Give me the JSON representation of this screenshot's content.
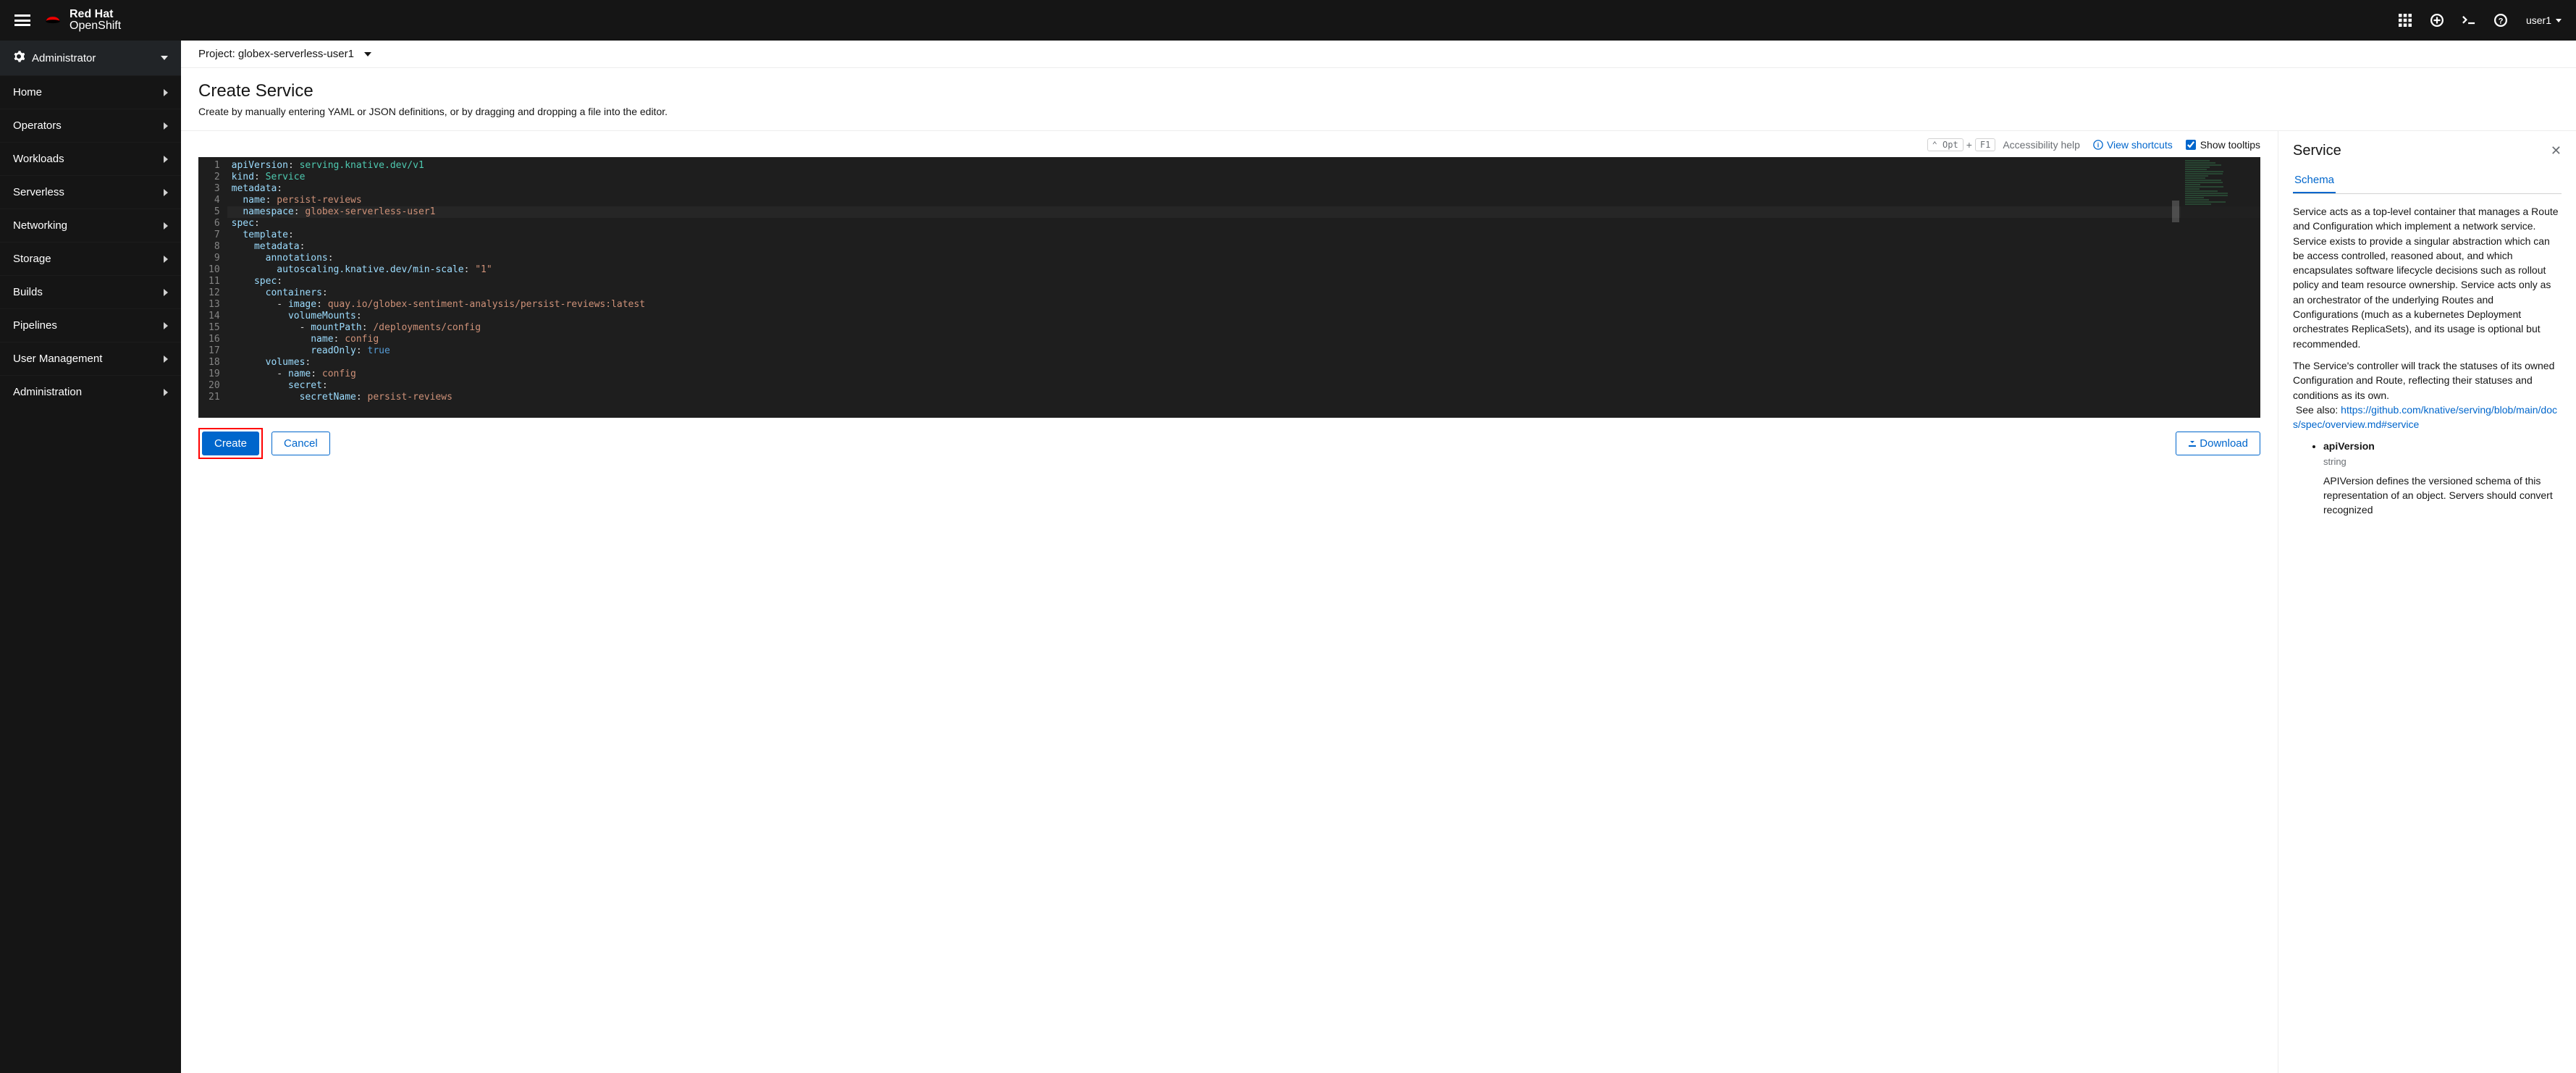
{
  "brand": {
    "line1": "Red Hat",
    "line2": "OpenShift"
  },
  "user": {
    "name": "user1"
  },
  "perspective": {
    "label": "Administrator"
  },
  "nav": [
    {
      "label": "Home"
    },
    {
      "label": "Operators"
    },
    {
      "label": "Workloads"
    },
    {
      "label": "Serverless"
    },
    {
      "label": "Networking"
    },
    {
      "label": "Storage"
    },
    {
      "label": "Builds"
    },
    {
      "label": "Pipelines"
    },
    {
      "label": "User Management"
    },
    {
      "label": "Administration"
    }
  ],
  "project": {
    "prefix": "Project:",
    "name": "globex-serverless-user1"
  },
  "page": {
    "title": "Create Service",
    "subtitle": "Create by manually entering YAML or JSON definitions, or by dragging and dropping a file into the editor."
  },
  "toolbar": {
    "kbd1": "⌃ Opt",
    "plus": "+",
    "kbd2": "F1",
    "a11y": "Accessibility help",
    "shortcuts": "View shortcuts",
    "tooltips": "Show tooltips"
  },
  "yaml": {
    "lines": [
      [
        [
          "key",
          "apiVersion"
        ],
        [
          "punc",
          ": "
        ],
        [
          "type",
          "serving.knative.dev/v1"
        ]
      ],
      [
        [
          "key",
          "kind"
        ],
        [
          "punc",
          ": "
        ],
        [
          "type",
          "Service"
        ]
      ],
      [
        [
          "key",
          "metadata"
        ],
        [
          "punc",
          ":"
        ]
      ],
      [
        [
          "pad",
          "  "
        ],
        [
          "key",
          "name"
        ],
        [
          "punc",
          ": "
        ],
        [
          "str",
          "persist-reviews"
        ]
      ],
      [
        [
          "pad",
          "  "
        ],
        [
          "key",
          "namespace"
        ],
        [
          "punc",
          ": "
        ],
        [
          "str",
          "globex-serverless-user1"
        ]
      ],
      [
        [
          "key",
          "spec"
        ],
        [
          "punc",
          ":"
        ]
      ],
      [
        [
          "pad",
          "  "
        ],
        [
          "key",
          "template"
        ],
        [
          "punc",
          ":"
        ]
      ],
      [
        [
          "pad",
          "    "
        ],
        [
          "key",
          "metadata"
        ],
        [
          "punc",
          ":"
        ]
      ],
      [
        [
          "pad",
          "      "
        ],
        [
          "key",
          "annotations"
        ],
        [
          "punc",
          ":"
        ]
      ],
      [
        [
          "pad",
          "        "
        ],
        [
          "key",
          "autoscaling.knative.dev/min-scale"
        ],
        [
          "punc",
          ": "
        ],
        [
          "str",
          "\"1\""
        ]
      ],
      [
        [
          "pad",
          "    "
        ],
        [
          "key",
          "spec"
        ],
        [
          "punc",
          ":"
        ]
      ],
      [
        [
          "pad",
          "      "
        ],
        [
          "key",
          "containers"
        ],
        [
          "punc",
          ":"
        ]
      ],
      [
        [
          "pad",
          "        "
        ],
        [
          "dash",
          "- "
        ],
        [
          "key",
          "image"
        ],
        [
          "punc",
          ": "
        ],
        [
          "str",
          "quay.io/globex-sentiment-analysis/persist-reviews:latest"
        ]
      ],
      [
        [
          "pad",
          "          "
        ],
        [
          "key",
          "volumeMounts"
        ],
        [
          "punc",
          ":"
        ]
      ],
      [
        [
          "pad",
          "            "
        ],
        [
          "dash",
          "- "
        ],
        [
          "key",
          "mountPath"
        ],
        [
          "punc",
          ": "
        ],
        [
          "str",
          "/deployments/config"
        ]
      ],
      [
        [
          "pad",
          "              "
        ],
        [
          "key",
          "name"
        ],
        [
          "punc",
          ": "
        ],
        [
          "str",
          "config"
        ]
      ],
      [
        [
          "pad",
          "              "
        ],
        [
          "key",
          "readOnly"
        ],
        [
          "punc",
          ": "
        ],
        [
          "bool",
          "true"
        ]
      ],
      [
        [
          "pad",
          "      "
        ],
        [
          "key",
          "volumes"
        ],
        [
          "punc",
          ":"
        ]
      ],
      [
        [
          "pad",
          "        "
        ],
        [
          "dash",
          "- "
        ],
        [
          "key",
          "name"
        ],
        [
          "punc",
          ": "
        ],
        [
          "str",
          "config"
        ]
      ],
      [
        [
          "pad",
          "          "
        ],
        [
          "key",
          "secret"
        ],
        [
          "punc",
          ":"
        ]
      ],
      [
        [
          "pad",
          "            "
        ],
        [
          "key",
          "secretName"
        ],
        [
          "punc",
          ": "
        ],
        [
          "str",
          "persist-reviews"
        ]
      ]
    ]
  },
  "actions": {
    "create": "Create",
    "cancel": "Cancel",
    "download": "Download"
  },
  "panel": {
    "title": "Service",
    "tab": "Schema",
    "desc": "Service acts as a top-level container that manages a Route and Configuration which implement a network service. Service exists to provide a singular abstraction which can be access controlled, reasoned about, and which encapsulates software lifecycle decisions such as rollout policy and team resource ownership. Service acts only as an orchestrator of the underlying Routes and Configurations (much as a kubernetes Deployment orchestrates ReplicaSets), and its usage is optional but recommended.",
    "desc2": "The Service's controller will track the statuses of its owned Configuration and Route, reflecting their statuses and conditions as its own.",
    "seealso": "See also:",
    "link": "https://github.com/knative/serving/blob/main/docs/spec/overview.md#service",
    "field": {
      "name": "apiVersion",
      "type": "string",
      "desc": "APIVersion defines the versioned schema of this representation of an object. Servers should convert recognized"
    }
  }
}
